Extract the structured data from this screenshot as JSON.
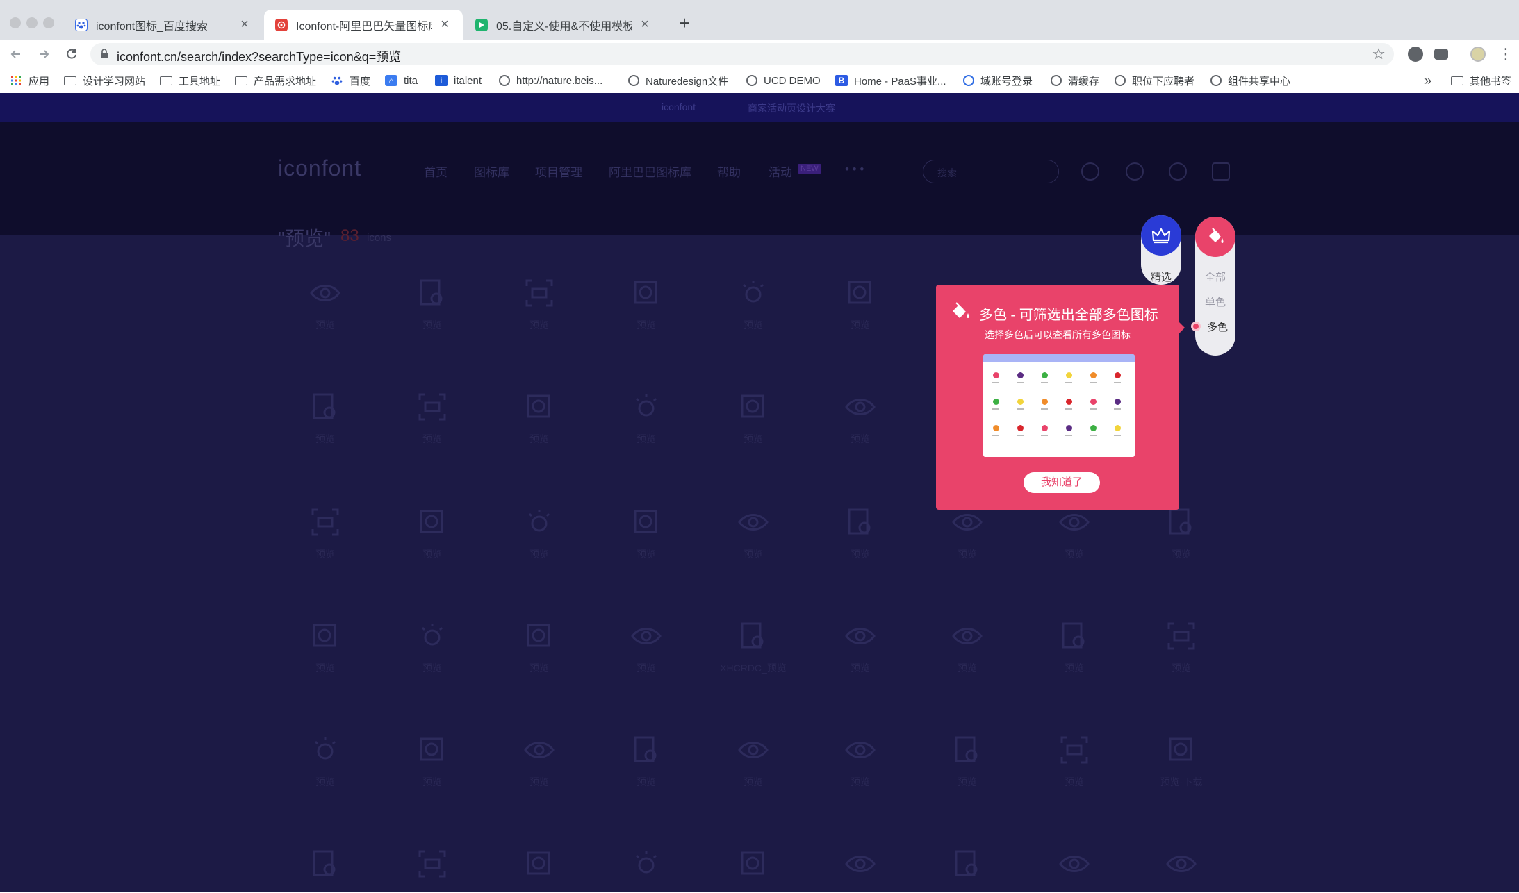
{
  "browser": {
    "tabs": [
      {
        "title": "iconfont图标_百度搜索",
        "favicon": "baidu-paw-icon",
        "close": "×"
      },
      {
        "title": "Iconfont-阿里巴巴矢量图标库",
        "favicon": "iconfont-logo-icon",
        "close": "×"
      },
      {
        "title": "05.自定义-使用&不使用模板-Ex",
        "favicon": "play-icon",
        "close": "×"
      }
    ],
    "new_tab": "+",
    "url": "iconfont.cn/search/index?searchType=icon&q=预览",
    "bookmarks": [
      {
        "label": "应用",
        "icon": "apps-grid-icon"
      },
      {
        "label": "设计学习网站",
        "icon": "folder-icon"
      },
      {
        "label": "工具地址",
        "icon": "folder-icon"
      },
      {
        "label": "产品需求地址",
        "icon": "folder-icon"
      },
      {
        "label": "百度",
        "icon": "baidu-paw-icon"
      },
      {
        "label": "tita",
        "icon": "tita-icon"
      },
      {
        "label": "italent",
        "icon": "italent-icon"
      },
      {
        "label": "http://nature.beis...",
        "icon": "globe-icon"
      },
      {
        "label": "Naturedesign文件",
        "icon": "globe-icon"
      },
      {
        "label": "UCD DEMO",
        "icon": "globe-icon"
      },
      {
        "label": "Home - PaaS事业...",
        "icon": "b-icon"
      },
      {
        "label": "域账号登录",
        "icon": "domain-icon"
      },
      {
        "label": "清缓存",
        "icon": "globe-icon"
      },
      {
        "label": "职位下应聘者",
        "icon": "globe-icon"
      },
      {
        "label": "组件共享中心",
        "icon": "globe-icon"
      }
    ],
    "more_bookmarks": "»",
    "other_bookmarks": "其他书签"
  },
  "site": {
    "promo_text": "商家活动页设计大赛",
    "logo": "iconfont",
    "nav": [
      "首页",
      "图标库",
      "项目管理",
      "阿里巴巴图标库",
      "帮助",
      "活动"
    ],
    "nav_badge": "NEW",
    "nav_more": "• • •",
    "search_placeholder": "搜索",
    "result_title": "\"预览\"",
    "result_count": "83",
    "result_unit": "icons"
  },
  "icon_rows": [
    [
      "预览",
      "预览",
      "预览",
      "预览",
      "预览",
      "预览"
    ],
    [
      "预览",
      "预览",
      "预览",
      "预览",
      "预览",
      "预览"
    ],
    [
      "预览",
      "预览",
      "预览",
      "预览",
      "预览",
      "预览",
      "预览",
      "预览",
      "预览"
    ],
    [
      "预览",
      "预览",
      "预览",
      "预览",
      "XHCRDC_预览",
      "预览",
      "预览",
      "预览",
      "预览"
    ],
    [
      "预览",
      "预览",
      "预览",
      "预览",
      "预览",
      "预览",
      "预览",
      "预览",
      "预览-下载"
    ]
  ],
  "filter": {
    "featured_label": "精选",
    "color_options": [
      "全部",
      "单色",
      "多色"
    ],
    "selected": "多色",
    "featured_color": "#2a3bd6",
    "accent_color": "#e9436a"
  },
  "tooltip": {
    "title": "多色 - 可筛选出全部多色图标",
    "subtitle": "选择多色后可以查看所有多色图标",
    "button": "我知道了"
  }
}
